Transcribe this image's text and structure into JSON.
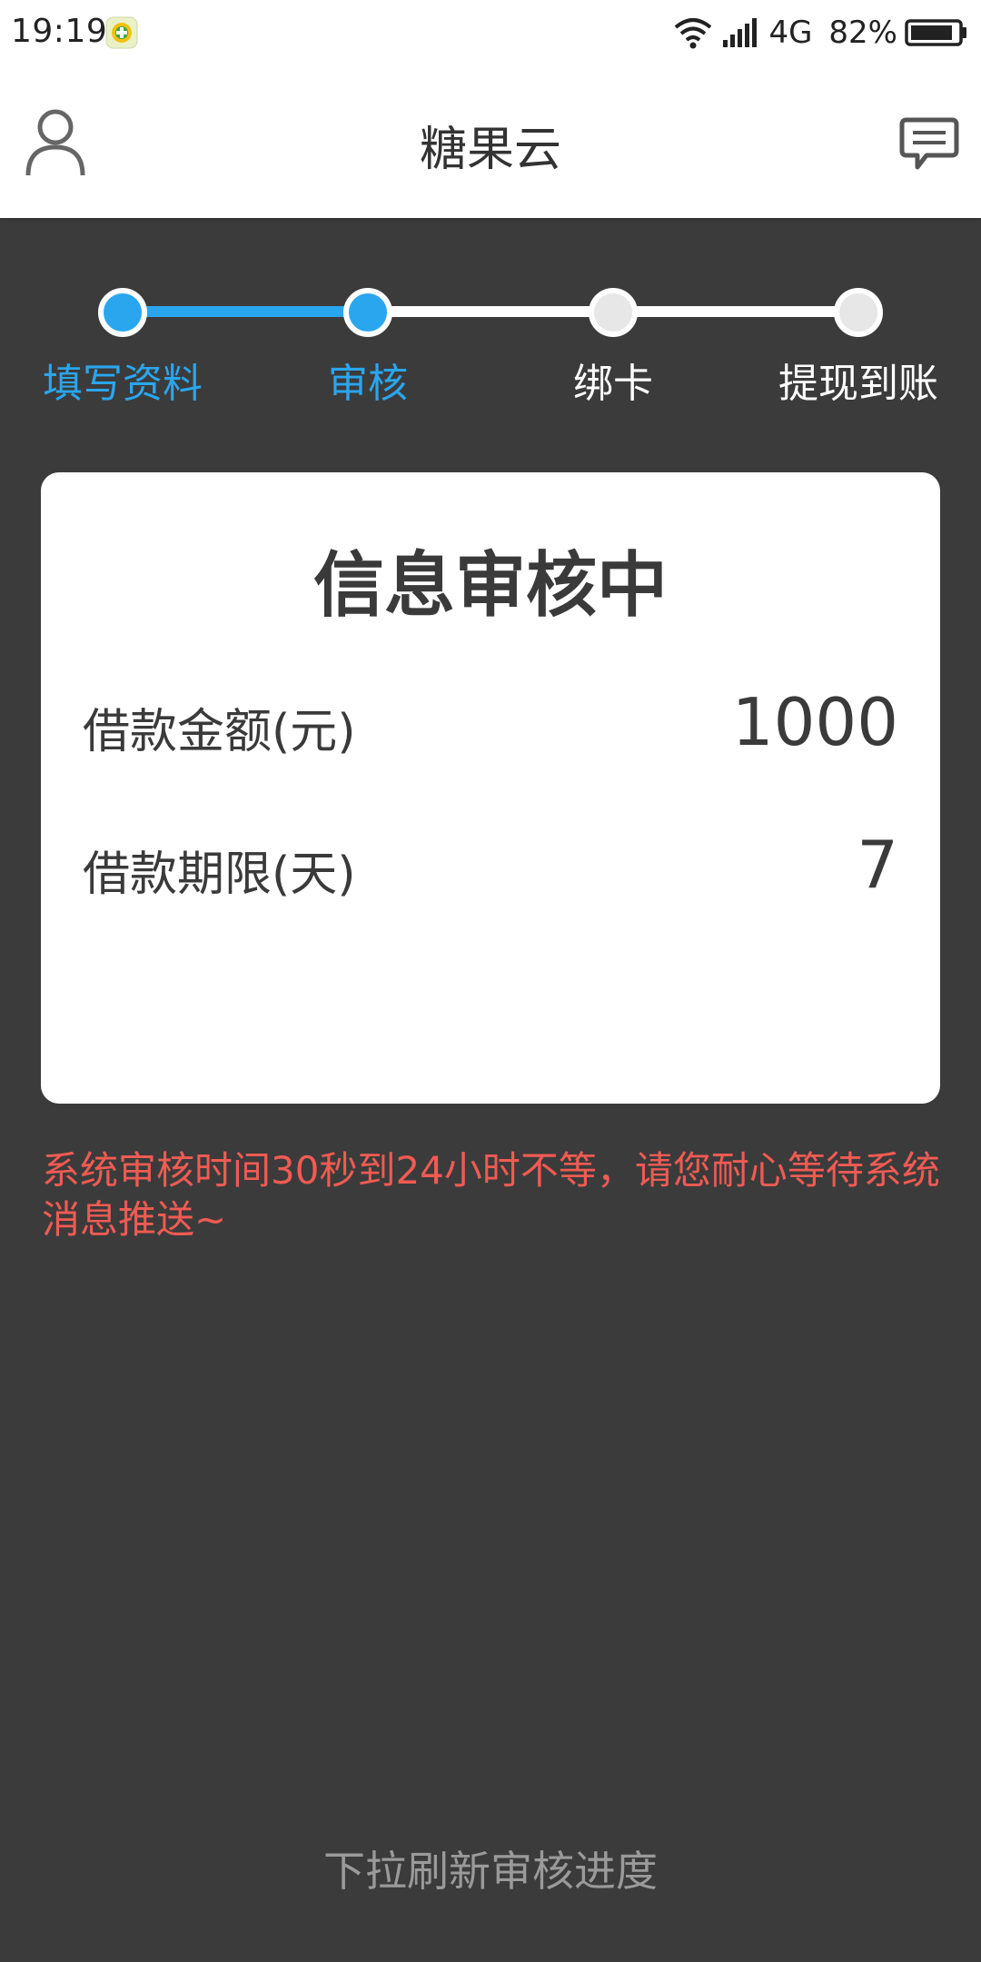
{
  "status_bar": {
    "time": "19:19",
    "network": "4G",
    "battery": "82%"
  },
  "header": {
    "title": "糖果云",
    "left_icon": "user-profile-icon",
    "right_icon": "message-icon"
  },
  "steps": [
    {
      "label": "填写资料",
      "state": "done"
    },
    {
      "label": "审核",
      "state": "current"
    },
    {
      "label": "绑卡",
      "state": "pending"
    },
    {
      "label": "提现到账",
      "state": "pending"
    }
  ],
  "colors": {
    "accent": "#2aa6ee",
    "background": "#3b3b3c",
    "warning": "#f05b52",
    "inactive_step": "#e7e7e7"
  },
  "card": {
    "title": "信息审核中",
    "rows": [
      {
        "label": "借款金额(元)",
        "value": "1000"
      },
      {
        "label": "借款期限(天)",
        "value": "7"
      }
    ]
  },
  "notice": "系统审核时间30秒到24小时不等，请您耐心等待系统消息推送~",
  "footer_hint": "下拉刷新审核进度"
}
